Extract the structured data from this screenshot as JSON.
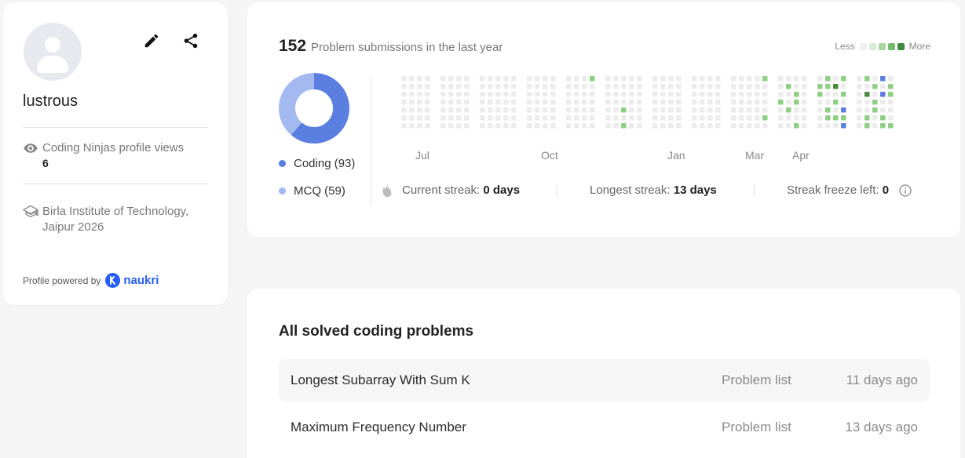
{
  "profile": {
    "username": "lustrous",
    "views_label": "Coding Ninjas profile views",
    "views_count": "6",
    "institute": "Birla Institute of Technology, Jaipur 2026",
    "powered_by": "Profile powered by",
    "powered_brand": "naukri",
    "icons": {
      "edit": "pencil-icon",
      "share": "share-icon",
      "views": "eye-icon",
      "institute": "graduation-cap-icon"
    }
  },
  "stats": {
    "submission_count": "152",
    "submission_label": "Problem submissions in the last year",
    "scale_less": "Less",
    "scale_more": "More",
    "scale_colors": [
      "#f0f0f0",
      "#d8ebd5",
      "#a9d5a1",
      "#74b96c",
      "#3f8a3a"
    ],
    "breakdown": [
      {
        "label": "Coding (93)",
        "value": 93,
        "color": "#5b7fe0"
      },
      {
        "label": "MCQ (59)",
        "value": 59,
        "color": "#a3b9f0"
      }
    ],
    "months": [
      "Jul",
      "Oct",
      "Jan",
      "Mar",
      "Apr"
    ],
    "streak": {
      "current_label": "Current streak:",
      "current_value": "0 days",
      "longest_label": "Longest streak:",
      "longest_value": "13 days",
      "freeze_label": "Streak freeze left:",
      "freeze_value": "0"
    },
    "colors": {
      "empty": "#ececec",
      "green": "#8fcf85",
      "dark": "#4a8a3f",
      "blue": "#5b7fe0"
    }
  },
  "problems": {
    "title": "All solved coding problems",
    "rows": [
      {
        "name": "Longest Subarray With Sum K",
        "source": "Problem list",
        "time": "11 days ago"
      },
      {
        "name": "Maximum Frequency Number",
        "source": "Problem list",
        "time": "13 days ago"
      }
    ]
  }
}
